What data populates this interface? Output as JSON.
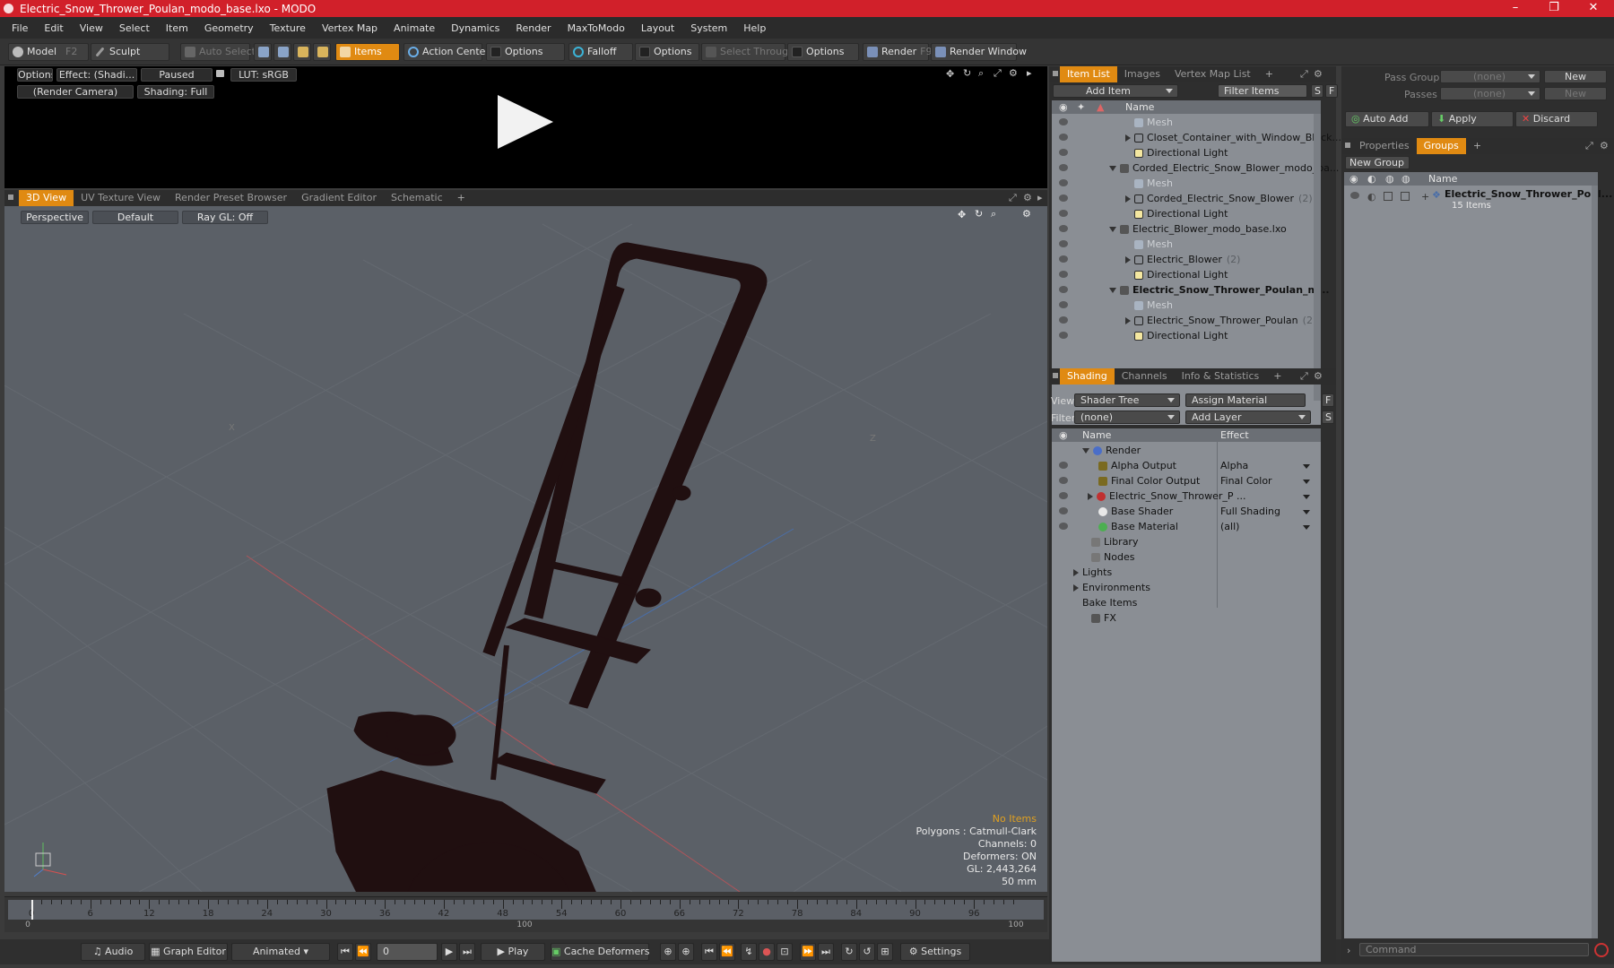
{
  "window": {
    "title": "Electric_Snow_Thrower_Poulan_modo_base.lxo - MODO",
    "minimize": "–",
    "maximize": "❐",
    "close": "✕"
  },
  "menu": [
    "File",
    "Edit",
    "View",
    "Select",
    "Item",
    "Geometry",
    "Texture",
    "Vertex Map",
    "Animate",
    "Dynamics",
    "Render",
    "MaxToModo",
    "Layout",
    "System",
    "Help"
  ],
  "toolbar": {
    "model": "Model",
    "model_key": "F2",
    "sculpt": "Sculpt",
    "auto_select": "Auto Select",
    "items": "Items",
    "action_center": "Action Center",
    "options1": "Options",
    "falloff": "Falloff",
    "options2": "Options",
    "select_through": "Select Through",
    "options3": "Options",
    "render": "Render",
    "render_key": "F9",
    "render_window": "Render Window"
  },
  "preview": {
    "options": "Options",
    "effect": "Effect: (Shadi...",
    "paused": "Paused",
    "lut": "LUT: sRGB",
    "camera": "(Render Camera)",
    "shading": "Shading: Full"
  },
  "viewport_tabs": [
    "3D View",
    "UV Texture View",
    "Render Preset Browser",
    "Gradient Editor",
    "Schematic",
    "+"
  ],
  "viewport": {
    "perspective": "Perspective",
    "default": "Default",
    "raygl": "Ray GL: Off",
    "info": {
      "no_items": "No Items",
      "polygons": "Polygons : Catmull-Clark",
      "channels": "Channels: 0",
      "deformers": "Deformers: ON",
      "gl": "GL: 2,443,264",
      "scale": "50 mm"
    },
    "axis_x": "X",
    "axis_z": "Z"
  },
  "timeline": {
    "ticks": [
      "0",
      "6",
      "12",
      "18",
      "24",
      "30",
      "36",
      "42",
      "48",
      "54",
      "60",
      "66",
      "72",
      "78",
      "84",
      "90",
      "96"
    ],
    "bottom_left": "0",
    "bottom_mid": "100",
    "bottom_right": "100"
  },
  "transport": {
    "audio": "Audio",
    "graph_editor": "Graph Editor",
    "animated": "Animated",
    "frame": "0",
    "play": "Play",
    "cache": "Cache Deformers",
    "settings": "Settings"
  },
  "item_list": {
    "tabs": [
      "Item List",
      "Images",
      "Vertex Map List",
      "+"
    ],
    "add_item": "Add Item",
    "filter": "Filter Items",
    "s": "S",
    "f": "F",
    "col_name": "Name",
    "rows": [
      {
        "label": "Mesh",
        "kind": "mesh"
      },
      {
        "label": "Closet_Container_with_Window_Black...",
        "kind": "locator"
      },
      {
        "label": "Directional Light",
        "kind": "light"
      },
      {
        "label": "Corded_Electric_Snow_Blower_modo_ba...",
        "kind": "scene"
      },
      {
        "label": "Mesh",
        "kind": "mesh"
      },
      {
        "label": "Corded_Electric_Snow_Blower",
        "count": "(2)",
        "kind": "locator"
      },
      {
        "label": "Directional Light",
        "kind": "light"
      },
      {
        "label": "Electric_Blower_modo_base.lxo",
        "kind": "scene"
      },
      {
        "label": "Mesh",
        "kind": "mesh"
      },
      {
        "label": "Electric_Blower",
        "count": "(2)",
        "kind": "locator"
      },
      {
        "label": "Directional Light",
        "kind": "light"
      },
      {
        "label": "Electric_Snow_Thrower_Poulan_m...",
        "kind": "scene"
      },
      {
        "label": "Mesh",
        "kind": "mesh"
      },
      {
        "label": "Electric_Snow_Thrower_Poulan",
        "count": "(2)",
        "kind": "locator"
      },
      {
        "label": "Directional Light",
        "kind": "light"
      }
    ]
  },
  "shading": {
    "tabs": [
      "Shading",
      "Channels",
      "Info & Statistics",
      "+"
    ],
    "view_label": "View",
    "view_value": "Shader Tree",
    "assign": "Assign Material",
    "f": "F",
    "filter_label": "Filter",
    "filter_value": "(none)",
    "add_layer": "Add Layer",
    "s": "S",
    "col_name": "Name",
    "col_effect": "Effect",
    "rows": [
      {
        "label": "Render",
        "effect": ""
      },
      {
        "label": "Alpha Output",
        "effect": "Alpha"
      },
      {
        "label": "Final Color Output",
        "effect": "Final Color"
      },
      {
        "label": "Electric_Snow_Thrower_P ...",
        "effect": ""
      },
      {
        "label": "Base Shader",
        "effect": "Full Shading"
      },
      {
        "label": "Base Material",
        "effect": "(all)"
      },
      {
        "label": "Library",
        "effect": ""
      },
      {
        "label": "Nodes",
        "effect": ""
      },
      {
        "label": "Lights",
        "effect": ""
      },
      {
        "label": "Environments",
        "effect": ""
      },
      {
        "label": "Bake Items",
        "effect": ""
      },
      {
        "label": "FX",
        "effect": ""
      }
    ]
  },
  "passes": {
    "pass_groups": "Pass Groups",
    "pass_value": "(none)",
    "new": "New",
    "passes": "Passes",
    "passes_value": "(none)",
    "new2": "New",
    "auto_add": "Auto Add",
    "apply": "Apply",
    "discard": "Discard"
  },
  "groups": {
    "tabs": [
      "Properties",
      "Groups",
      "+"
    ],
    "new_group": "New Group",
    "col_name": "Name",
    "group_name": "Electric_Snow_Thrower_Poul...",
    "group_count": "15 Items"
  },
  "command": {
    "placeholder": "Command"
  }
}
